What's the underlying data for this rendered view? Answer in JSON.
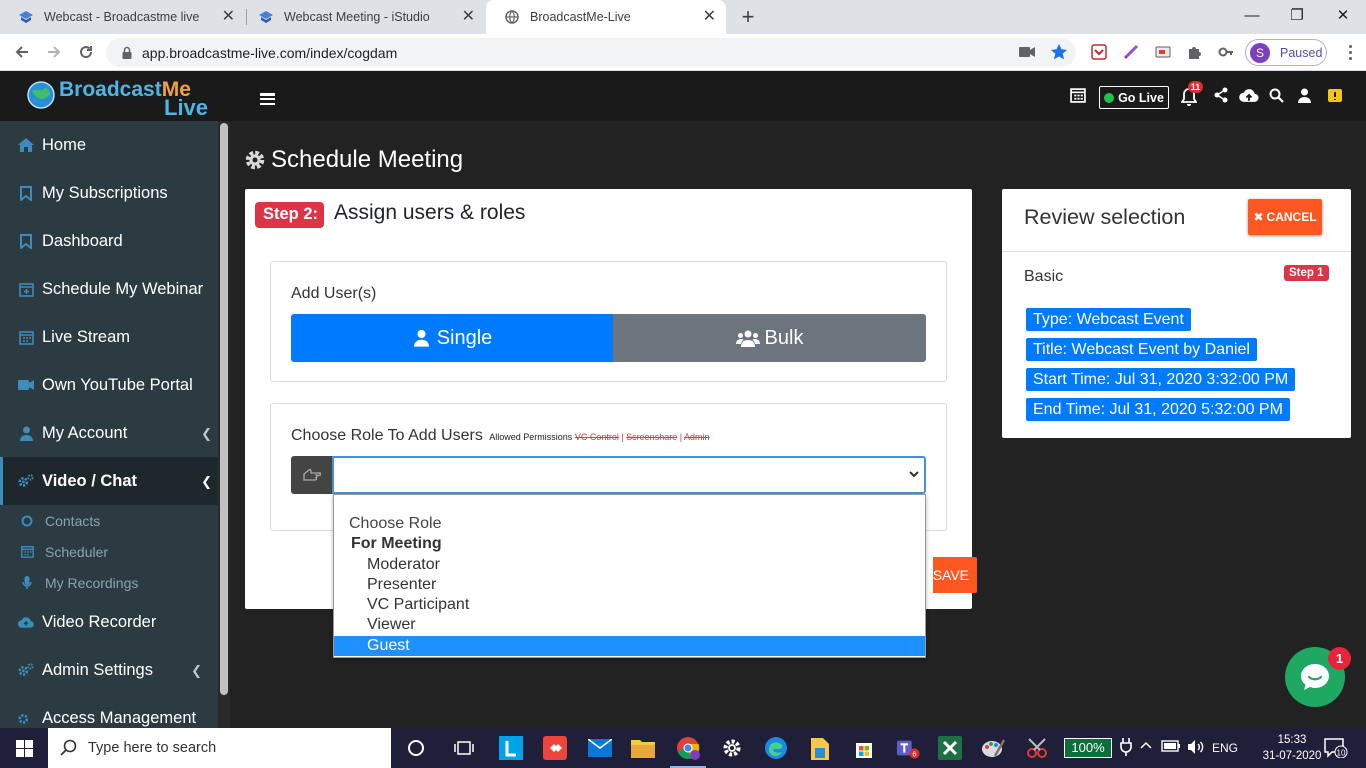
{
  "browser": {
    "tabs": [
      {
        "title": "Webcast - Broadcastme live"
      },
      {
        "title": "Webcast Meeting - iStudio"
      },
      {
        "title": "BroadcastMe-Live"
      }
    ],
    "url": "app.broadcastme-live.com/index/cogdam",
    "profile_initial": "S",
    "profile_status": "Paused"
  },
  "brand": {
    "part1": "Broadcast",
    "part2": "Me",
    "part3": "Live"
  },
  "sidebar": {
    "items": [
      {
        "label": "Home"
      },
      {
        "label": "My Subscriptions"
      },
      {
        "label": "Dashboard"
      },
      {
        "label": "Schedule My Webinar"
      },
      {
        "label": "Live Stream"
      },
      {
        "label": "Own YouTube Portal"
      },
      {
        "label": "My Account"
      },
      {
        "label": "Video / Chat"
      },
      {
        "label": "Video Recorder"
      },
      {
        "label": "Admin Settings"
      },
      {
        "label": "Access Management"
      }
    ],
    "subitems": [
      {
        "label": "Contacts"
      },
      {
        "label": "Scheduler"
      },
      {
        "label": "My Recordings"
      }
    ]
  },
  "topnav": {
    "go_live": "Go Live",
    "notifications": "11"
  },
  "page": {
    "title": "Schedule Meeting"
  },
  "step": {
    "label": "Step 2:",
    "title": "Assign users & roles"
  },
  "add_users": {
    "label": "Add User(s)",
    "single": "Single",
    "bulk": "Bulk"
  },
  "role": {
    "label": "Choose Role To Add Users",
    "allowed": "Allowed Permissions",
    "perm1": "VC Control",
    "perm2": "Screenshare",
    "perm3": "Admin",
    "sep": " | "
  },
  "save_label": "SAVE",
  "dropdown": {
    "options": [
      "Choose Role",
      "For Meeting",
      "Moderator",
      "Presenter",
      "VC Participant",
      "Viewer",
      "Guest"
    ]
  },
  "review": {
    "title": "Review selection",
    "cancel": "CANCEL",
    "section": "Basic",
    "step": "Step 1",
    "type": "Type: Webcast Event",
    "title_field": "Title: Webcast Event by Daniel",
    "start": "Start Time: Jul 31, 2020 3:32:00 PM",
    "end": "End Time: Jul 31, 2020 5:32:00 PM"
  },
  "chat": {
    "badge": "1"
  },
  "taskbar": {
    "search_placeholder": "Type here to search",
    "zoom": "100%",
    "lang": "ENG",
    "time": "15:33",
    "date": "31-07-2020",
    "notif_count": "10"
  },
  "colors": {
    "primary": "#007bff",
    "danger": "#dc3545",
    "accent_orange": "#ff5722",
    "sidebar": "#2c3b41",
    "topbar": "#1a1a1a"
  }
}
